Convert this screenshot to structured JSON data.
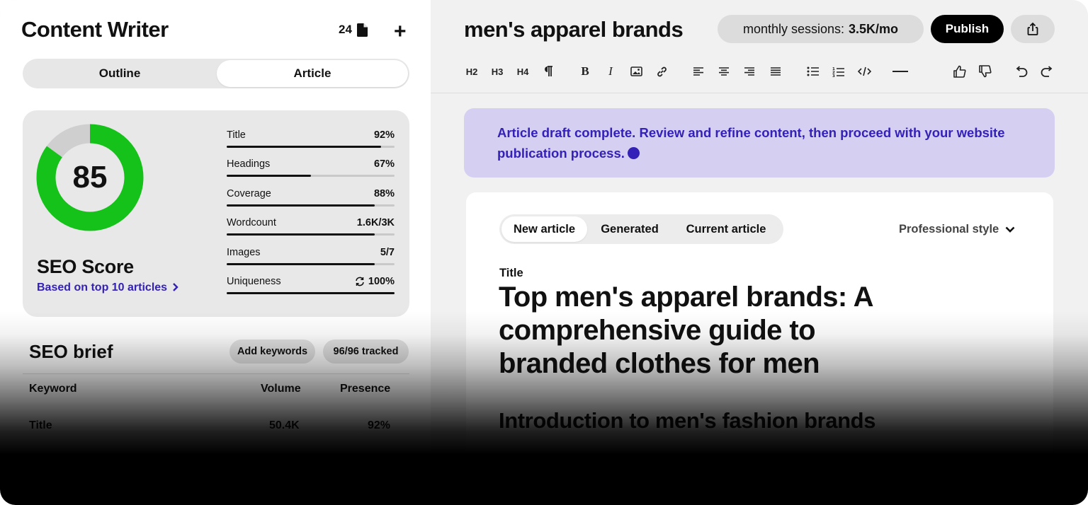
{
  "app": {
    "title": "Content Writer",
    "doc_count": "24",
    "add_icon": "plus-icon"
  },
  "mode_toggle": {
    "options": [
      "Outline",
      "Article"
    ],
    "selected": "Article"
  },
  "seo_card": {
    "score": "85",
    "score_fraction": 0.85,
    "label": "SEO Score",
    "link": "Based on top 10 articles",
    "colors": {
      "ring": "#15c21a",
      "ring_bg": "#cfcfcf",
      "link": "#3321b8"
    },
    "metrics": [
      {
        "label": "Title",
        "value": "92%",
        "fraction": 0.92
      },
      {
        "label": "Headings",
        "value": "67%",
        "fraction": 0.5
      },
      {
        "label": "Coverage",
        "value": "88%",
        "fraction": 0.88
      },
      {
        "label": "Wordcount",
        "value": "1.6K/3K",
        "fraction": 0.88
      },
      {
        "label": "Images",
        "value": "5/7",
        "fraction": 0.88
      },
      {
        "label": "Uniqueness",
        "value": "100%",
        "fraction": 1.0,
        "icon": "refresh-icon"
      }
    ]
  },
  "seo_brief": {
    "title": "SEO brief",
    "add_keywords": "Add keywords",
    "tracked": "96/96 tracked",
    "columns": [
      "Keyword",
      "Volume",
      "Presence"
    ],
    "rows": [
      {
        "keyword": "Title",
        "volume": "50.4K",
        "presence": "92%"
      }
    ]
  },
  "header": {
    "doc_title": "men's apparel brands",
    "sessions_label": "monthly sessions:",
    "sessions_value": "3.5K/mo",
    "publish": "Publish",
    "share_icon": "share-icon"
  },
  "toolbar": {
    "h2": "H2",
    "h3": "H3",
    "h4": "H4"
  },
  "banner": {
    "text": "Article draft complete. Review and refine content, then proceed with your website publication process.",
    "color": "#d5cff2"
  },
  "editor": {
    "tabs": [
      "New article",
      "Generated",
      "Current article"
    ],
    "selected_tab": "New article",
    "style": "Professional style",
    "field_label": "Title",
    "title": "Top men's apparel brands: A comprehensive guide to branded clothes for men",
    "section_heading": "Introduction to men's fashion brands"
  }
}
